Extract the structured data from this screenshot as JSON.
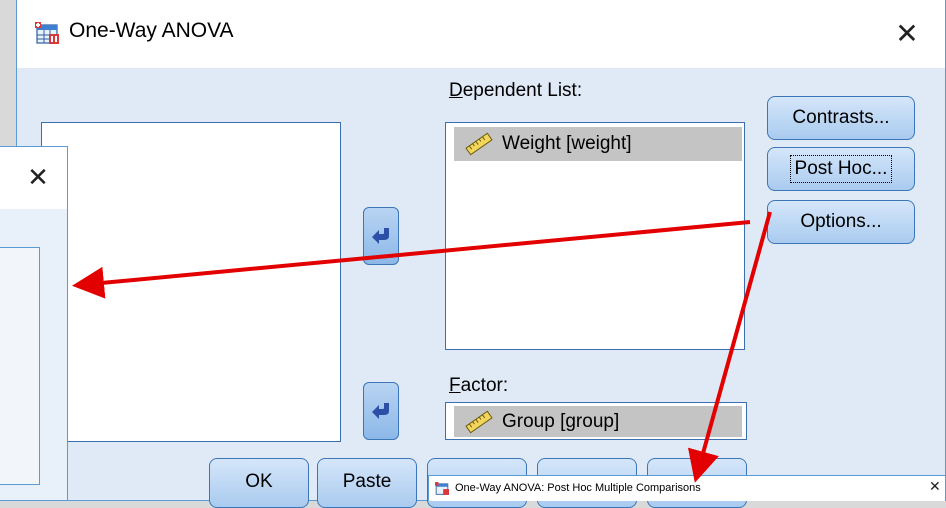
{
  "dialog": {
    "title": "One-Way ANOVA",
    "close": "✕"
  },
  "dependent": {
    "label": "Dependent List:",
    "items": [
      "Weight [weight]"
    ]
  },
  "factor": {
    "label": "Factor:",
    "item": "Group [group]"
  },
  "side_buttons": {
    "contrasts": "Contrasts...",
    "post_hoc": "Post Hoc...",
    "options": "Options..."
  },
  "bottom_buttons": {
    "ok": "OK",
    "paste": "Paste"
  },
  "left_panel": {
    "close": "✕"
  },
  "post_hoc_dialog": {
    "title": "One-Way ANOVA: Post Hoc Multiple Comparisons",
    "close": "✕"
  },
  "icons": {
    "app": "spss-table-icon",
    "variable": "ruler-icon",
    "move": "curved-arrow-icon"
  },
  "colors": {
    "dialog_bg": "#dfeaf6",
    "button_border": "#3d76b8",
    "selected_item": "#c4c4c4",
    "annotation_arrow": "#e30000"
  }
}
